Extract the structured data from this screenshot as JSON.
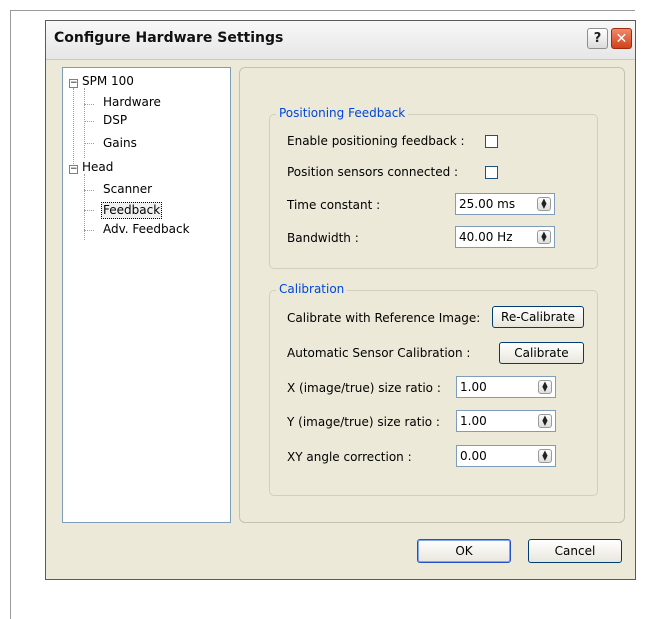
{
  "dialog": {
    "title": "Configure Hardware Settings",
    "help_glyph": "?",
    "close_glyph": "✕"
  },
  "tree": {
    "root1": "SPM 100",
    "root1_children": [
      "Hardware",
      "DSP",
      "Gains"
    ],
    "root2": "Head",
    "root2_children": [
      "Scanner",
      "Feedback",
      "Adv. Feedback"
    ],
    "selected": "Feedback",
    "expander_glyph": "−"
  },
  "positioning": {
    "legend": "Positioning Feedback",
    "enable_label": "Enable positioning feedback :",
    "enable_checked": false,
    "sensors_label": "Position sensors connected :",
    "sensors_checked": false,
    "time_constant_label": "Time constant  :",
    "time_constant_value": "25.00 ms",
    "bandwidth_label": "Bandwidth      :",
    "bandwidth_value": "40.00 Hz"
  },
  "calibration": {
    "legend": "Calibration",
    "ref_image_label": "Calibrate with Reference Image:",
    "recalibrate_button": "Re-Calibrate",
    "auto_sensor_label": "Automatic Sensor Calibration :",
    "calibrate_button": "Calibrate",
    "x_ratio_label": "X (image/true) size ratio :",
    "x_ratio_value": "1.00",
    "y_ratio_label": "Y (image/true) size ratio :",
    "y_ratio_value": "1.00",
    "xy_angle_label": "XY angle correction     :",
    "xy_angle_value": "0.00"
  },
  "footer": {
    "ok_button": "OK",
    "cancel_button": "Cancel"
  },
  "spin_glyph_up": "▲",
  "spin_glyph_down": "▼"
}
